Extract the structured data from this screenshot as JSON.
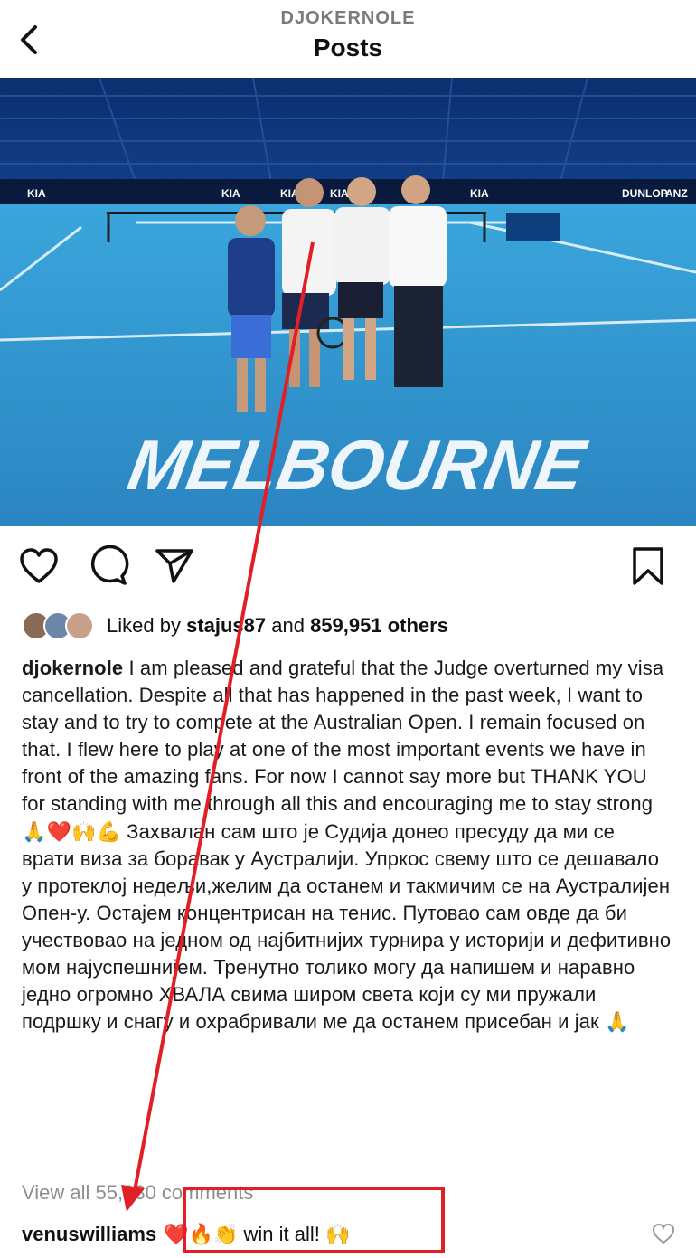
{
  "header": {
    "username": "DJOKERNOLE",
    "title": "Posts"
  },
  "post": {
    "photo_text": "MELBOURNE",
    "likes": {
      "prefix": "Liked by ",
      "user": "stajus87",
      "middle": " and ",
      "count": "859,951 others"
    },
    "caption": {
      "author": "djokernole",
      "text": "I am pleased and grateful that the Judge overturned my visa cancellation. Despite all that has happened in the past week, I want to stay and to try to compete at the Australian Open.  I remain focused on that. I flew here to play at one of the most important events we have in front of the amazing fans.  For now I cannot say more but THANK YOU for standing with me through all this and encouraging me to stay strong 🙏❤️🙌💪 Захвалан сам што је Судија донео пресуду да ми се врати виза за боравак у Аустралији. Упркос свему што се дешавало у протеклој недељи,желим да останем и такмичим се на Аустралијен Опен-у. Остајем концентрисан на тенис. Путовао сам овде да би учествовао на једном од најбитнијих турнира у историји и дефитивно мом најуспешнијем. Тренутно толико могу да напишем и наравно једно огромно ХВАЛА свима широм света који су ми пружали подршку и снагу и охрабривали ме да останем присебан и јак 🙏"
    },
    "view_comments": "View all 55,230 comments",
    "top_comment": {
      "author": "venuswilliams",
      "text": "❤️🔥👏 win it all! 🙌"
    }
  },
  "colors": {
    "annotation": "#e21f26",
    "muted_text": "#8e8e8e",
    "court": "#2d86c1"
  },
  "icons": [
    "back-chevron-icon",
    "heart-icon",
    "comment-bubble-icon",
    "paper-plane-icon",
    "bookmark-icon",
    "small-heart-icon"
  ]
}
